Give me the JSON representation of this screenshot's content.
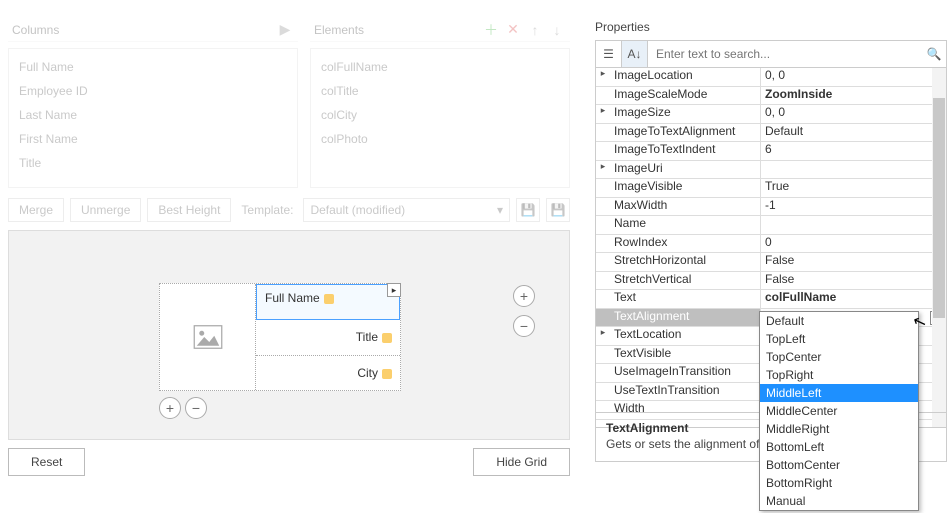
{
  "panels": {
    "columns": {
      "title": "Columns",
      "items": [
        "Full Name",
        "Employee ID",
        "Last Name",
        "First Name",
        "Title"
      ]
    },
    "elements": {
      "title": "Elements",
      "items": [
        "colFullName",
        "colTitle",
        "colCity",
        "colPhoto"
      ]
    }
  },
  "toolbar": {
    "merge": "Merge",
    "unmerge": "Unmerge",
    "bestheight": "Best Height",
    "template_lbl": "Template:",
    "template_val": "Default (modified)"
  },
  "canvas": {
    "fullname": "Full Name",
    "title": "Title",
    "city": "City"
  },
  "buttons": {
    "reset": "Reset",
    "hidegrid": "Hide Grid"
  },
  "props": {
    "title": "Properties",
    "search_placeholder": "Enter text to search...",
    "rows": [
      {
        "exp": "▸",
        "k": "ImageLocation",
        "v": "0, 0"
      },
      {
        "exp": "",
        "k": "ImageScaleMode",
        "v": "ZoomInside",
        "bold": true
      },
      {
        "exp": "▸",
        "k": "ImageSize",
        "v": "0, 0"
      },
      {
        "exp": "",
        "k": "ImageToTextAlignment",
        "v": "Default"
      },
      {
        "exp": "",
        "k": "ImageToTextIndent",
        "v": "6"
      },
      {
        "exp": "▸",
        "k": "ImageUri",
        "v": ""
      },
      {
        "exp": "",
        "k": "ImageVisible",
        "v": "True"
      },
      {
        "exp": "",
        "k": "MaxWidth",
        "v": "-1"
      },
      {
        "exp": "",
        "k": "Name",
        "v": ""
      },
      {
        "exp": "",
        "k": "RowIndex",
        "v": "0"
      },
      {
        "exp": "",
        "k": "StretchHorizontal",
        "v": "False"
      },
      {
        "exp": "",
        "k": "StretchVertical",
        "v": "False"
      },
      {
        "exp": "",
        "k": "Text",
        "v": "colFullName",
        "bold": true
      },
      {
        "exp": "",
        "k": "TextAlignment",
        "v": "MiddleLeft",
        "sel": true
      },
      {
        "exp": "▸",
        "k": "TextLocation",
        "v": ""
      },
      {
        "exp": "",
        "k": "TextVisible",
        "v": ""
      },
      {
        "exp": "",
        "k": "UseImageInTransition",
        "v": ""
      },
      {
        "exp": "",
        "k": "UseTextInTransition",
        "v": ""
      },
      {
        "exp": "",
        "k": "Width",
        "v": ""
      }
    ],
    "dropdown": [
      "Default",
      "TopLeft",
      "TopCenter",
      "TopRight",
      "MiddleLeft",
      "MiddleCenter",
      "MiddleRight",
      "BottomLeft",
      "BottomCenter",
      "BottomRight",
      "Manual"
    ],
    "dropdown_selected": "MiddleLeft",
    "desc_head": "TextAlignment",
    "desc_body": "Gets or sets the alignment of the T"
  }
}
